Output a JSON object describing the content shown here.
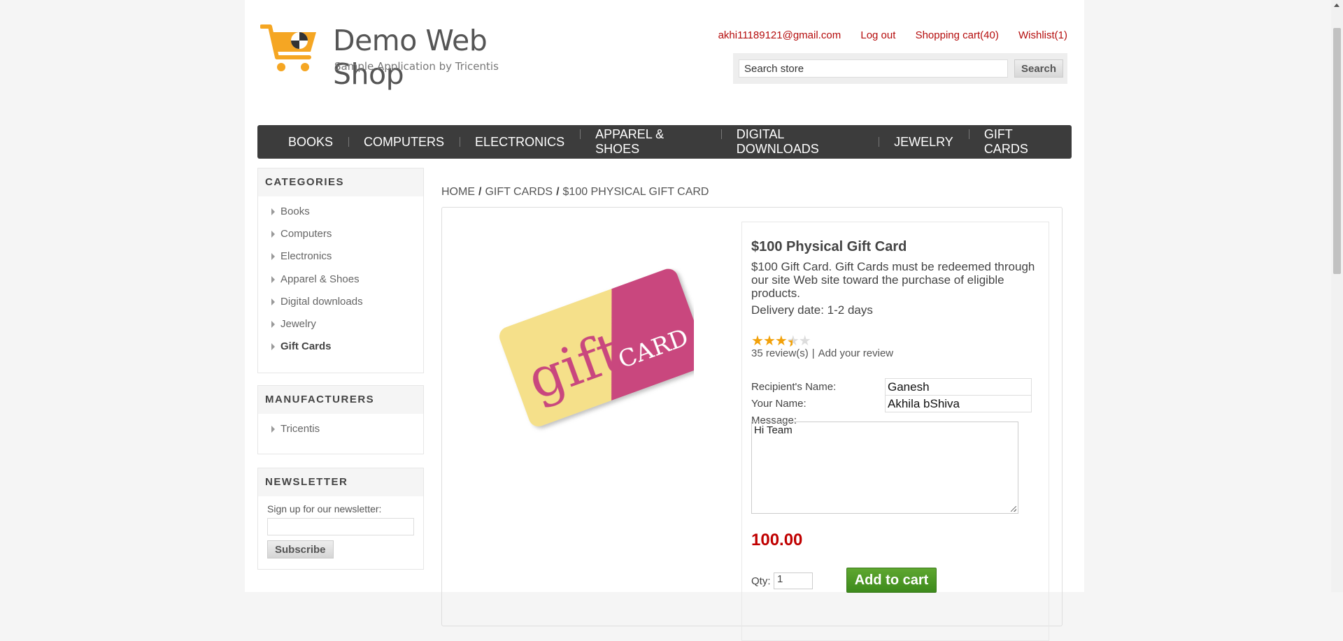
{
  "header": {
    "logo_title": "Demo Web Shop",
    "logo_subtitle": "Sample Application by Tricentis",
    "account_email": "akhi11189121@gmail.com",
    "logout": "Log out",
    "cart": "Shopping cart(40)",
    "wishlist": "Wishlist(1)",
    "search_value": "Search store",
    "search_button": "Search"
  },
  "menu": [
    "BOOKS",
    "COMPUTERS",
    "ELECTRONICS",
    "APPAREL & SHOES",
    "DIGITAL DOWNLOADS",
    "JEWELRY",
    "GIFT CARDS"
  ],
  "sidebar": {
    "categories_title": "CATEGORIES",
    "categories": [
      "Books",
      "Computers",
      "Electronics",
      "Apparel & Shoes",
      "Digital downloads",
      "Jewelry",
      "Gift Cards"
    ],
    "manufacturers_title": "MANUFACTURERS",
    "manufacturers": [
      "Tricentis"
    ],
    "newsletter_title": "NEWSLETTER",
    "newsletter_label": "Sign up for our newsletter:",
    "newsletter_button": "Subscribe"
  },
  "breadcrumb": {
    "home": "HOME",
    "category": "GIFT CARDS",
    "current": "$100 PHYSICAL GIFT CARD",
    "separator": "/"
  },
  "product": {
    "image_text_1": "gift",
    "image_text_2": "CARD",
    "name": "$100 Physical Gift Card",
    "description": "$100 Gift Card. Gift Cards must be redeemed through our site Web site toward the purchase of eligible products.",
    "delivery": "Delivery date: 1-2 days",
    "rating_of_5": 3.5,
    "reviews": "35 review(s)",
    "review_separator": "|",
    "add_review": "Add your review",
    "recipient_label": "Recipient's Name:",
    "recipient_value": "Ganesh",
    "your_name_label": "Your Name:",
    "your_name_value": "Akhila bShiva",
    "message_label": "Message:",
    "message_value": "Hi Team",
    "price": "100.00",
    "qty_label": "Qty:",
    "qty_value": "1",
    "add_to_cart": "Add to cart"
  },
  "colors": {
    "link_red": "#b50d0d",
    "menu_bg": "#3c3c3c",
    "price_red": "#c00000",
    "button_green": "#4e9a26",
    "star": "#f2a10a"
  }
}
